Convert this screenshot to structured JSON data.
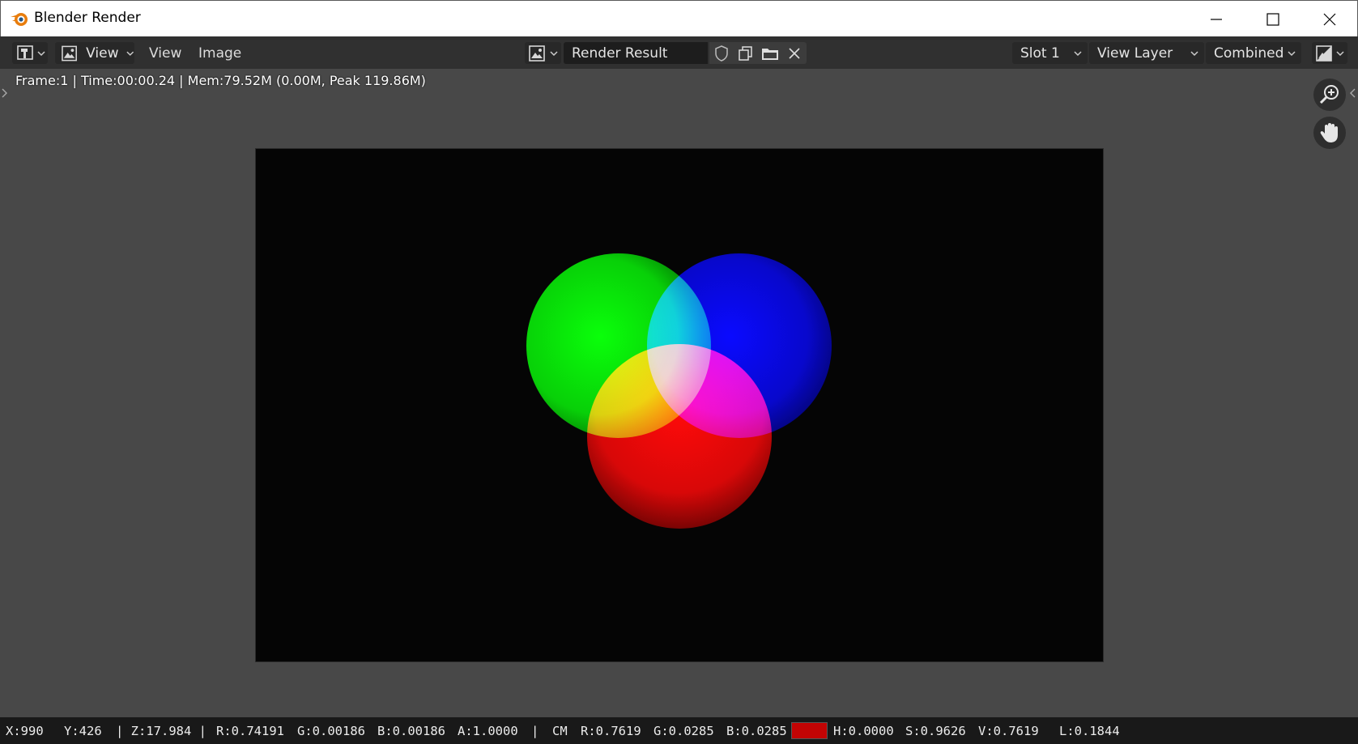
{
  "window": {
    "title": "Blender Render"
  },
  "header": {
    "view_label": "View",
    "menu_view": "View",
    "menu_image": "Image",
    "image_name": "Render Result",
    "slot": "Slot 1",
    "view_layer": "View Layer",
    "pass": "Combined"
  },
  "viewport": {
    "info": "Frame:1 | Time:00:00.24 | Mem:79.52M (0.00M, Peak 119.86M)"
  },
  "status": {
    "x": "X:990",
    "y": "Y:426",
    "z": "| Z:17.984 |",
    "r": "R:0.74191",
    "g": "G:0.00186",
    "b": "B:0.00186",
    "a": "A:1.0000",
    "sep": "|",
    "cm": "CM",
    "cm_r": "R:0.7619",
    "cm_g": "G:0.0285",
    "cm_b": "B:0.0285",
    "h": "H:0.0000",
    "s": "S:0.9626",
    "v": "V:0.7619",
    "l": "L:0.1844",
    "swatch_color": "#c20404"
  },
  "icons": [
    "blender-logo-icon",
    "minimize-icon",
    "maximize-icon",
    "close-icon",
    "editor-type-icon",
    "image-icon",
    "fake-user-shield-icon",
    "new-image-icon",
    "open-image-icon",
    "unlink-icon",
    "zoom-icon",
    "pan-hand-icon",
    "display-channels-icon"
  ]
}
